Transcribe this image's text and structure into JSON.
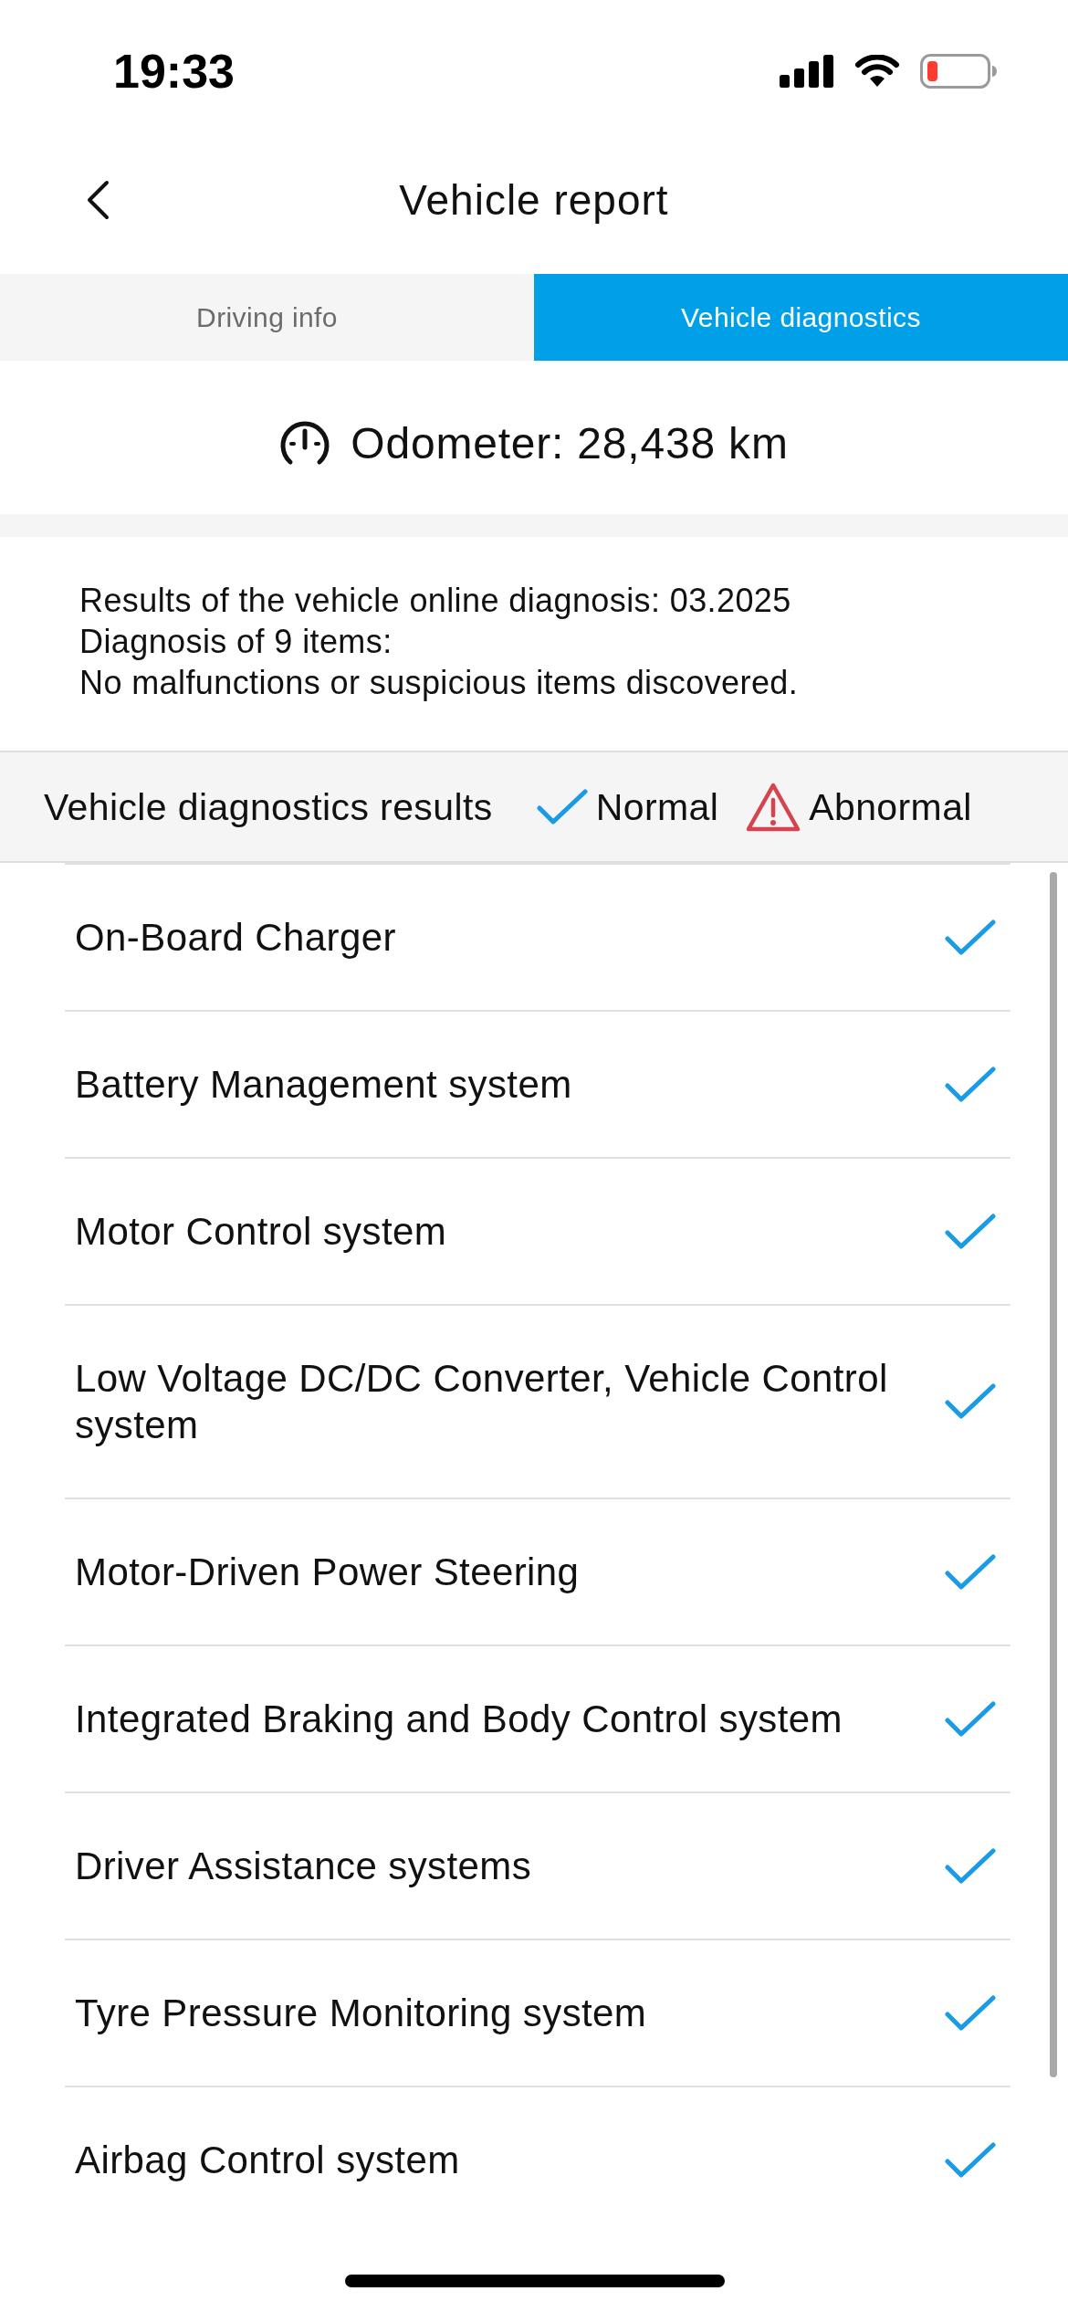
{
  "status_bar": {
    "time": "19:33"
  },
  "header": {
    "title": "Vehicle report"
  },
  "tabs": [
    {
      "label": "Driving info",
      "selected": false
    },
    {
      "label": "Vehicle diagnostics",
      "selected": true
    }
  ],
  "odometer": {
    "text": "Odometer: 28,438 km"
  },
  "summary": {
    "lines": [
      "Results of the vehicle online diagnosis: 03.2025",
      "Diagnosis of 9 items:",
      "No malfunctions or suspicious items discovered."
    ]
  },
  "legend": {
    "title": "Vehicle diagnostics results",
    "items": [
      {
        "kind": "normal",
        "label": "Normal"
      },
      {
        "kind": "abnormal",
        "label": "Abnormal"
      }
    ]
  },
  "results": [
    {
      "name": "On-Board Charger",
      "abnormal": false
    },
    {
      "name": "Battery Management system",
      "abnormal": false
    },
    {
      "name": "Motor Control system",
      "abnormal": false
    },
    {
      "name": "Low Voltage DC/DC Converter, Vehicle Control system",
      "abnormal": false
    },
    {
      "name": "Motor-Driven Power Steering",
      "abnormal": false
    },
    {
      "name": "Integrated Braking and Body Control system",
      "abnormal": false
    },
    {
      "name": "Driver Assistance systems",
      "abnormal": false
    },
    {
      "name": "Tyre Pressure Monitoring system",
      "abnormal": false
    },
    {
      "name": "Airbag Control system",
      "abnormal": false
    }
  ]
}
